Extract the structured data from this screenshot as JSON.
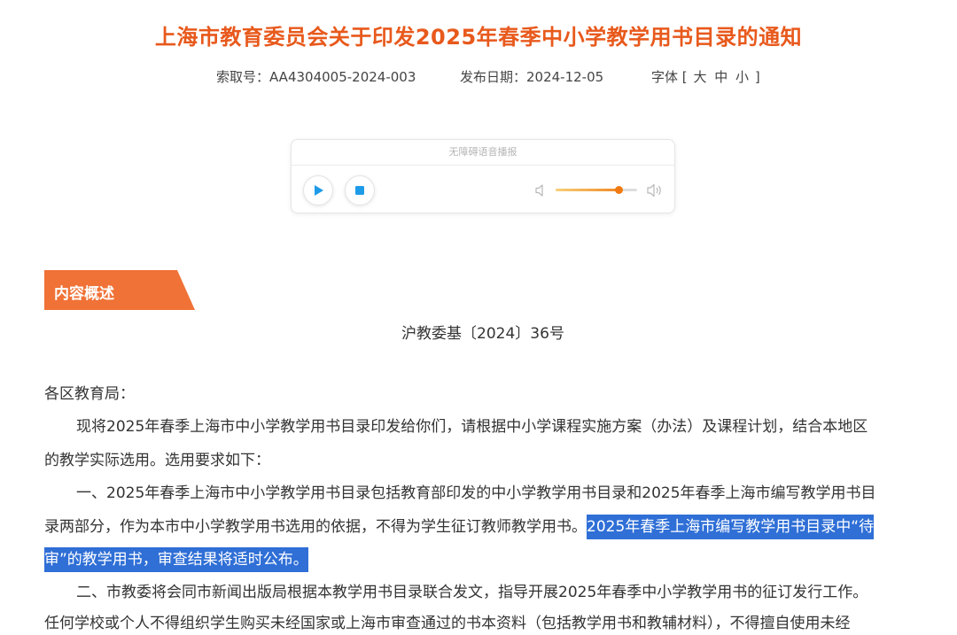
{
  "document": {
    "title": "上海市教育委员会关于印发2025年春季中小学教学用书目录的通知",
    "index_no": "索取号：AA4304005-2024-003",
    "publish_date": "发布日期：2024-12-05",
    "font_size": {
      "prefix": "字体",
      "open": "[",
      "large": "大",
      "medium": "中",
      "small": "小",
      "close": "]"
    }
  },
  "player": {
    "header": "无障碍语音播报",
    "volume_level": 0.77,
    "accent_color": "#f07a12",
    "icons": [
      "play-icon",
      "stop-icon",
      "volume-low-icon",
      "volume-high-icon"
    ]
  },
  "section": {
    "banner": "内容概述",
    "banner_color": "#f07236"
  },
  "content": {
    "doc_number": "沪教委基〔2024〕36号",
    "salutation": "各区教育局：",
    "p1_line1": "现将2025年春季上海市中小学教学用书目录印发给你们，请根据中小学课程实施方案（办法）及课程计划，结合本地区",
    "p1_line2": "的教学实际选用。选用要求如下：",
    "p2_line1": "一、2025年春季上海市中小学教学用书目录包括教育部印发的中小学教学用书目录和2025年春季上海市编写教学用书目",
    "p2_line2_plain": "录两部分，作为本市中小学教学用书选用的依据，不得为学生征订教师教学用书。",
    "p2_line2_highlight": "2025年春季上海市编写教学用书目录中“待",
    "p2_line3_highlight": "审”的教学用书，审查结果将适时公布。",
    "p3_line1": "二、市教委将会同市新闻出版局根据本教学用书目录联合发文，指导开展2025年春季中小学教学用书的征订发行工作。",
    "p3_line2": "任何学校或个人不得组织学生购买未经国家或上海市审查通过的书本资料（包括教学用书和教辅材料），不得擅自使用未经"
  },
  "colors": {
    "title": "#e8591c",
    "highlight_bg": "#2f6fd6"
  }
}
